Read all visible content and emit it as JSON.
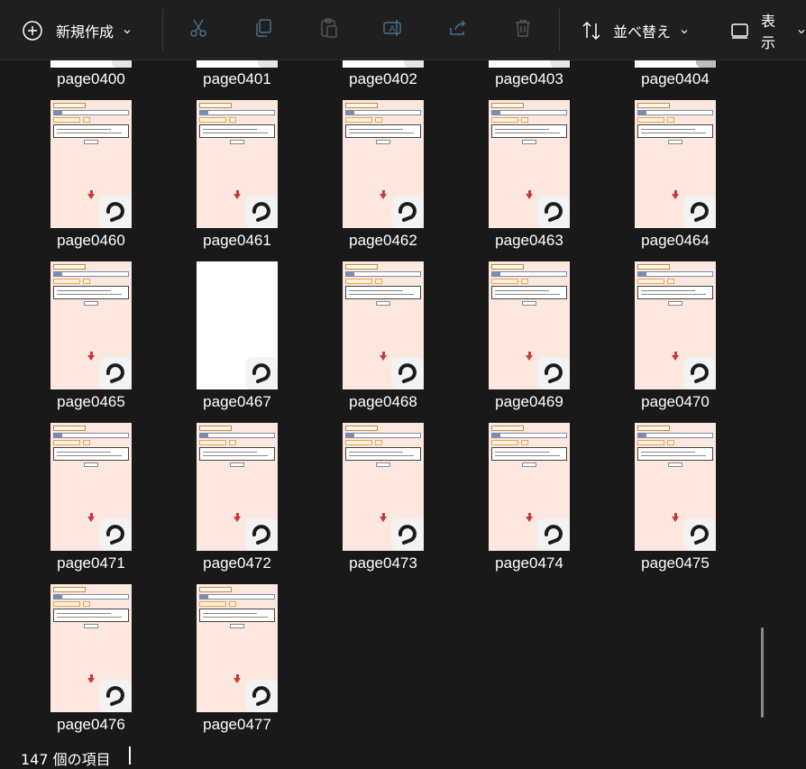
{
  "toolbar": {
    "new_label": "新規作成",
    "sort_label": "並べ替え",
    "view_label": "表示",
    "icons": [
      "cut-icon",
      "copy-icon",
      "paste-icon",
      "rename-icon",
      "share-icon",
      "delete-icon"
    ]
  },
  "files": {
    "row0": [
      "page0400",
      "page0401",
      "page0402",
      "page0403",
      "page0404"
    ],
    "row1": [
      "page0460",
      "page0461",
      "page0462",
      "page0463",
      "page0464"
    ],
    "row2": [
      "page0465",
      "page0467",
      "page0468",
      "page0469",
      "page0470"
    ],
    "row3": [
      "page0471",
      "page0472",
      "page0473",
      "page0474",
      "page0475"
    ],
    "row4": [
      "page0476",
      "page0477"
    ]
  },
  "status": {
    "item_count": "147 個の項目"
  },
  "colors": {
    "background": "#191919",
    "thumb_bg": "#fde8df",
    "arrow": "#c83a3a"
  }
}
